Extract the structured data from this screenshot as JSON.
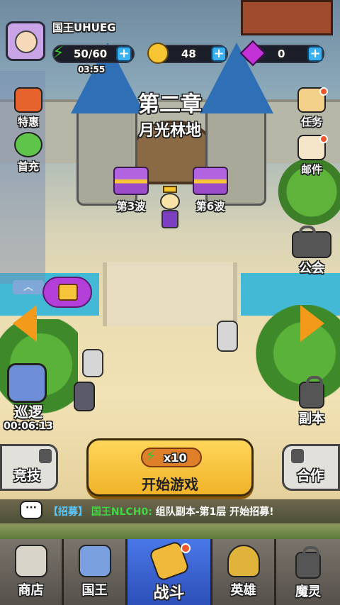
{
  "player": {
    "name": "国王UHUEG"
  },
  "resources": {
    "energy": "50/60",
    "energy_timer": "03:55",
    "gold": "48",
    "gems": "0"
  },
  "chapter": {
    "number": "第二章",
    "name": "月光林地"
  },
  "chests": [
    {
      "label": "第3波"
    },
    {
      "label": "第6波"
    }
  ],
  "left_menu": [
    {
      "label": "特惠"
    },
    {
      "label": "首充"
    }
  ],
  "right_menu": [
    {
      "label": "任务"
    },
    {
      "label": "邮件"
    },
    {
      "label": "公会"
    },
    {
      "label": "副本"
    },
    {
      "label": "合作"
    }
  ],
  "patrol": {
    "label": "巡逻",
    "timer": "00:06:13"
  },
  "arena": {
    "label": "竞技"
  },
  "start_button": {
    "cost": "x10",
    "label": "开始游戏"
  },
  "chat": {
    "tag": "【招募】",
    "sender": "国王NLCH0:",
    "message": "组队副本-第1层 开始招募!"
  },
  "nav": [
    {
      "label": "商店"
    },
    {
      "label": "国王"
    },
    {
      "label": "战斗"
    },
    {
      "label": "英雄"
    },
    {
      "label": "魔灵"
    }
  ],
  "colors": {
    "start_button": "#f6c33c",
    "accent_green": "#3cc23c",
    "nav_active": "#3d63d6"
  }
}
